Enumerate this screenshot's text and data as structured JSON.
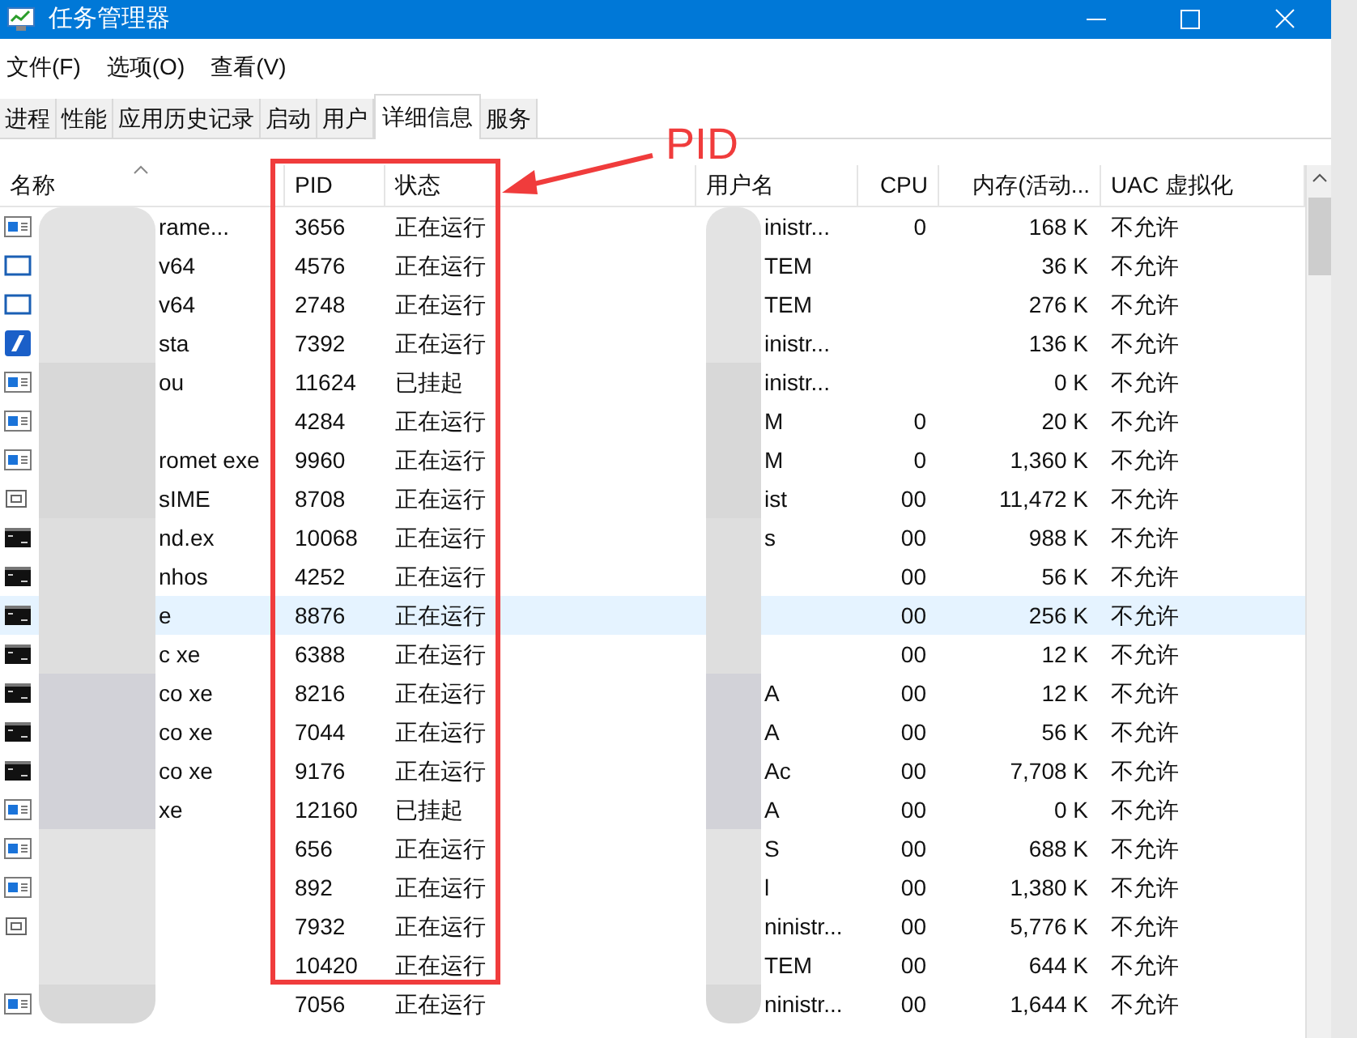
{
  "window": {
    "title": "任务管理器"
  },
  "menu": [
    "文件(F)",
    "选项(O)",
    "查看(V)"
  ],
  "tabs": [
    {
      "label": "进程",
      "selected": false
    },
    {
      "label": "性能",
      "selected": false
    },
    {
      "label": "应用历史记录",
      "selected": false
    },
    {
      "label": "启动",
      "selected": false
    },
    {
      "label": "用户",
      "selected": false
    },
    {
      "label": "详细信息",
      "selected": true
    },
    {
      "label": "服务",
      "selected": false
    }
  ],
  "table": {
    "columns": [
      "名称",
      "PID",
      "状态",
      "用户名",
      "CPU",
      "内存(活动...",
      "UAC 虚拟化"
    ],
    "rows": [
      {
        "kind": "window",
        "name": "rame...",
        "pid": "3656",
        "state": "正在运行",
        "user": "inistr...",
        "cpu": "0",
        "memory": "168 K",
        "uac": "不允许",
        "selected": false
      },
      {
        "kind": "frame",
        "name": "v64",
        "pid": "4576",
        "state": "正在运行",
        "user": "TEM",
        "cpu": "",
        "memory": "36 K",
        "uac": "不允许",
        "selected": false
      },
      {
        "kind": "frame",
        "name": "v64",
        "pid": "2748",
        "state": "正在运行",
        "user": "TEM",
        "cpu": "",
        "memory": "276 K",
        "uac": "不允许",
        "selected": false
      },
      {
        "kind": "logo",
        "name": "sta",
        "pid": "7392",
        "state": "正在运行",
        "user": "inistr...",
        "cpu": "",
        "memory": "136 K",
        "uac": "不允许",
        "selected": false
      },
      {
        "kind": "window",
        "name": "ou",
        "pid": "11624",
        "state": "已挂起",
        "user": "inistr...",
        "cpu": "",
        "memory": "0 K",
        "uac": "不允许",
        "selected": false
      },
      {
        "kind": "window",
        "name": "",
        "pid": "4284",
        "state": "正在运行",
        "user": "M",
        "cpu": "0",
        "memory": "20 K",
        "uac": "不允许",
        "selected": false
      },
      {
        "kind": "window",
        "name": "romet exe",
        "pid": "9960",
        "state": "正在运行",
        "user": "M",
        "cpu": "0",
        "memory": "1,360 K",
        "uac": "不允许",
        "selected": false
      },
      {
        "kind": "small",
        "name": "sIME",
        "pid": "8708",
        "state": "正在运行",
        "user": "ist",
        "cpu": "00",
        "memory": "11,472 K",
        "uac": "不允许",
        "selected": false
      },
      {
        "kind": "console",
        "name": "nd.ex",
        "pid": "10068",
        "state": "正在运行",
        "user": "s",
        "cpu": "00",
        "memory": "988 K",
        "uac": "不允许",
        "selected": false
      },
      {
        "kind": "console",
        "name": "nhos",
        "pid": "4252",
        "state": "正在运行",
        "user": "",
        "cpu": "00",
        "memory": "56 K",
        "uac": "不允许",
        "selected": false
      },
      {
        "kind": "console",
        "name": "e",
        "pid": "8876",
        "state": "正在运行",
        "user": "",
        "cpu": "00",
        "memory": "256 K",
        "uac": "不允许",
        "selected": true
      },
      {
        "kind": "console",
        "name": "c xe",
        "pid": "6388",
        "state": "正在运行",
        "user": "",
        "cpu": "00",
        "memory": "12 K",
        "uac": "不允许",
        "selected": false
      },
      {
        "kind": "console",
        "name": "co xe",
        "pid": "8216",
        "state": "正在运行",
        "user": "A",
        "cpu": "00",
        "memory": "12 K",
        "uac": "不允许",
        "selected": false
      },
      {
        "kind": "console",
        "name": "co xe",
        "pid": "7044",
        "state": "正在运行",
        "user": "A",
        "cpu": "00",
        "memory": "56 K",
        "uac": "不允许",
        "selected": false
      },
      {
        "kind": "console",
        "name": "co xe",
        "pid": "9176",
        "state": "正在运行",
        "user": "Ac",
        "cpu": "00",
        "memory": "7,708 K",
        "uac": "不允许",
        "selected": false
      },
      {
        "kind": "window",
        "name": "xe",
        "pid": "12160",
        "state": "已挂起",
        "user": "A",
        "cpu": "00",
        "memory": "0 K",
        "uac": "不允许",
        "selected": false
      },
      {
        "kind": "window",
        "name": "",
        "pid": "656",
        "state": "正在运行",
        "user": "S",
        "cpu": "00",
        "memory": "688 K",
        "uac": "不允许",
        "selected": false
      },
      {
        "kind": "window",
        "name": "",
        "pid": "892",
        "state": "正在运行",
        "user": "l",
        "cpu": "00",
        "memory": "1,380 K",
        "uac": "不允许",
        "selected": false
      },
      {
        "kind": "small",
        "name": "",
        "pid": "7932",
        "state": "正在运行",
        "user": "ninistr...",
        "cpu": "00",
        "memory": "5,776 K",
        "uac": "不允许",
        "selected": false
      },
      {
        "kind": "none",
        "name": "",
        "pid": "10420",
        "state": "正在运行",
        "user": "TEM",
        "cpu": "00",
        "memory": "644 K",
        "uac": "不允许",
        "selected": false
      },
      {
        "kind": "window",
        "name": "",
        "pid": "7056",
        "state": "正在运行",
        "user": "ninistr...",
        "cpu": "00",
        "memory": "1,644 K",
        "uac": "不允许",
        "selected": false
      }
    ]
  },
  "annotation": {
    "label": "PID"
  }
}
